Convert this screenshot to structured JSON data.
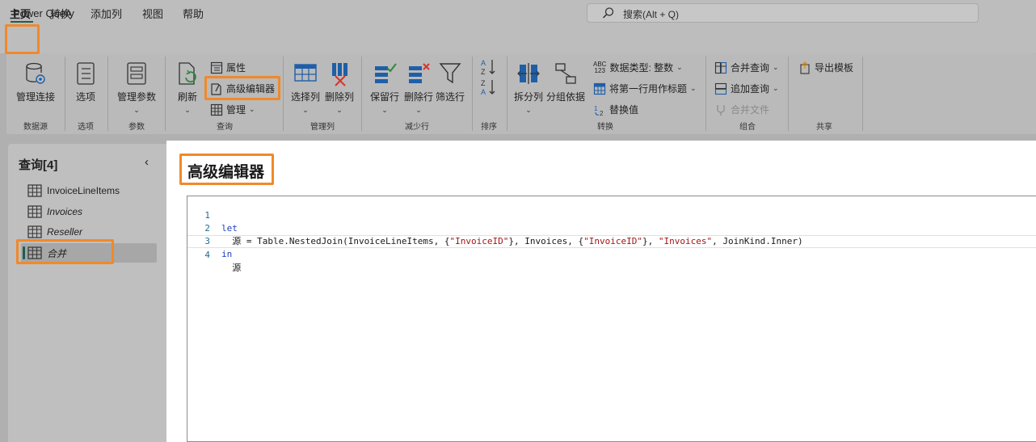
{
  "app": {
    "title": "Power Query"
  },
  "search": {
    "placeholder": "搜索(Alt + Q)"
  },
  "menu": {
    "items": [
      "主页",
      "转换",
      "添加列",
      "视图",
      "帮助"
    ]
  },
  "ribbon": {
    "data_source": {
      "manage_connections": "管理连接",
      "group": "数据源"
    },
    "options": {
      "options": "选项",
      "group": "选项"
    },
    "parameters": {
      "manage_params": "管理参数",
      "group": "参数"
    },
    "query": {
      "refresh": "刷新",
      "properties": "属性",
      "advanced_editor": "高级编辑器",
      "manage": "管理",
      "group": "查询"
    },
    "columns": {
      "choose": "选择列",
      "remove": "删除列",
      "group": "管理列"
    },
    "reduce_rows": {
      "keep": "保留行",
      "remove": "删除行",
      "filter": "筛选行",
      "group": "减少行"
    },
    "sort": {
      "group": "排序"
    },
    "transform": {
      "split": "拆分列",
      "group_by": "分组依据",
      "data_type": "数据类型: 整数",
      "first_row": "将第一行用作标题",
      "replace": "替换值",
      "group": "转换",
      "type_icon_top": "ABC",
      "type_icon_bottom": "123"
    },
    "combine": {
      "merge": "合并查询",
      "append": "追加查询",
      "combine_files": "合并文件",
      "group": "组合"
    },
    "share": {
      "export": "导出模板",
      "group": "共享"
    }
  },
  "sidebar": {
    "title": "查询[4]",
    "queries": [
      {
        "name": "InvoiceLineItems"
      },
      {
        "name": "Invoices"
      },
      {
        "name": "Reseller"
      },
      {
        "name": "合并"
      }
    ]
  },
  "editor": {
    "title": "高级编辑器",
    "lines": [
      {
        "num": "1",
        "text": "let"
      },
      {
        "num": "2",
        "p1": "  源 = Table.NestedJoin(InvoiceLineItems, {",
        "s1": "\"InvoiceID\"",
        "p2": "}, Invoices, {",
        "s2": "\"InvoiceID\"",
        "p3": "}, ",
        "s3": "\"Invoices\"",
        "p4": ", JoinKind.Inner)"
      },
      {
        "num": "3",
        "text": "in"
      },
      {
        "num": "4",
        "text": "  源"
      }
    ]
  },
  "colors": {
    "highlight": "#f0892a",
    "accent": "#1b5f52",
    "keyword": "#1e3fbf",
    "string": "#a31515"
  }
}
